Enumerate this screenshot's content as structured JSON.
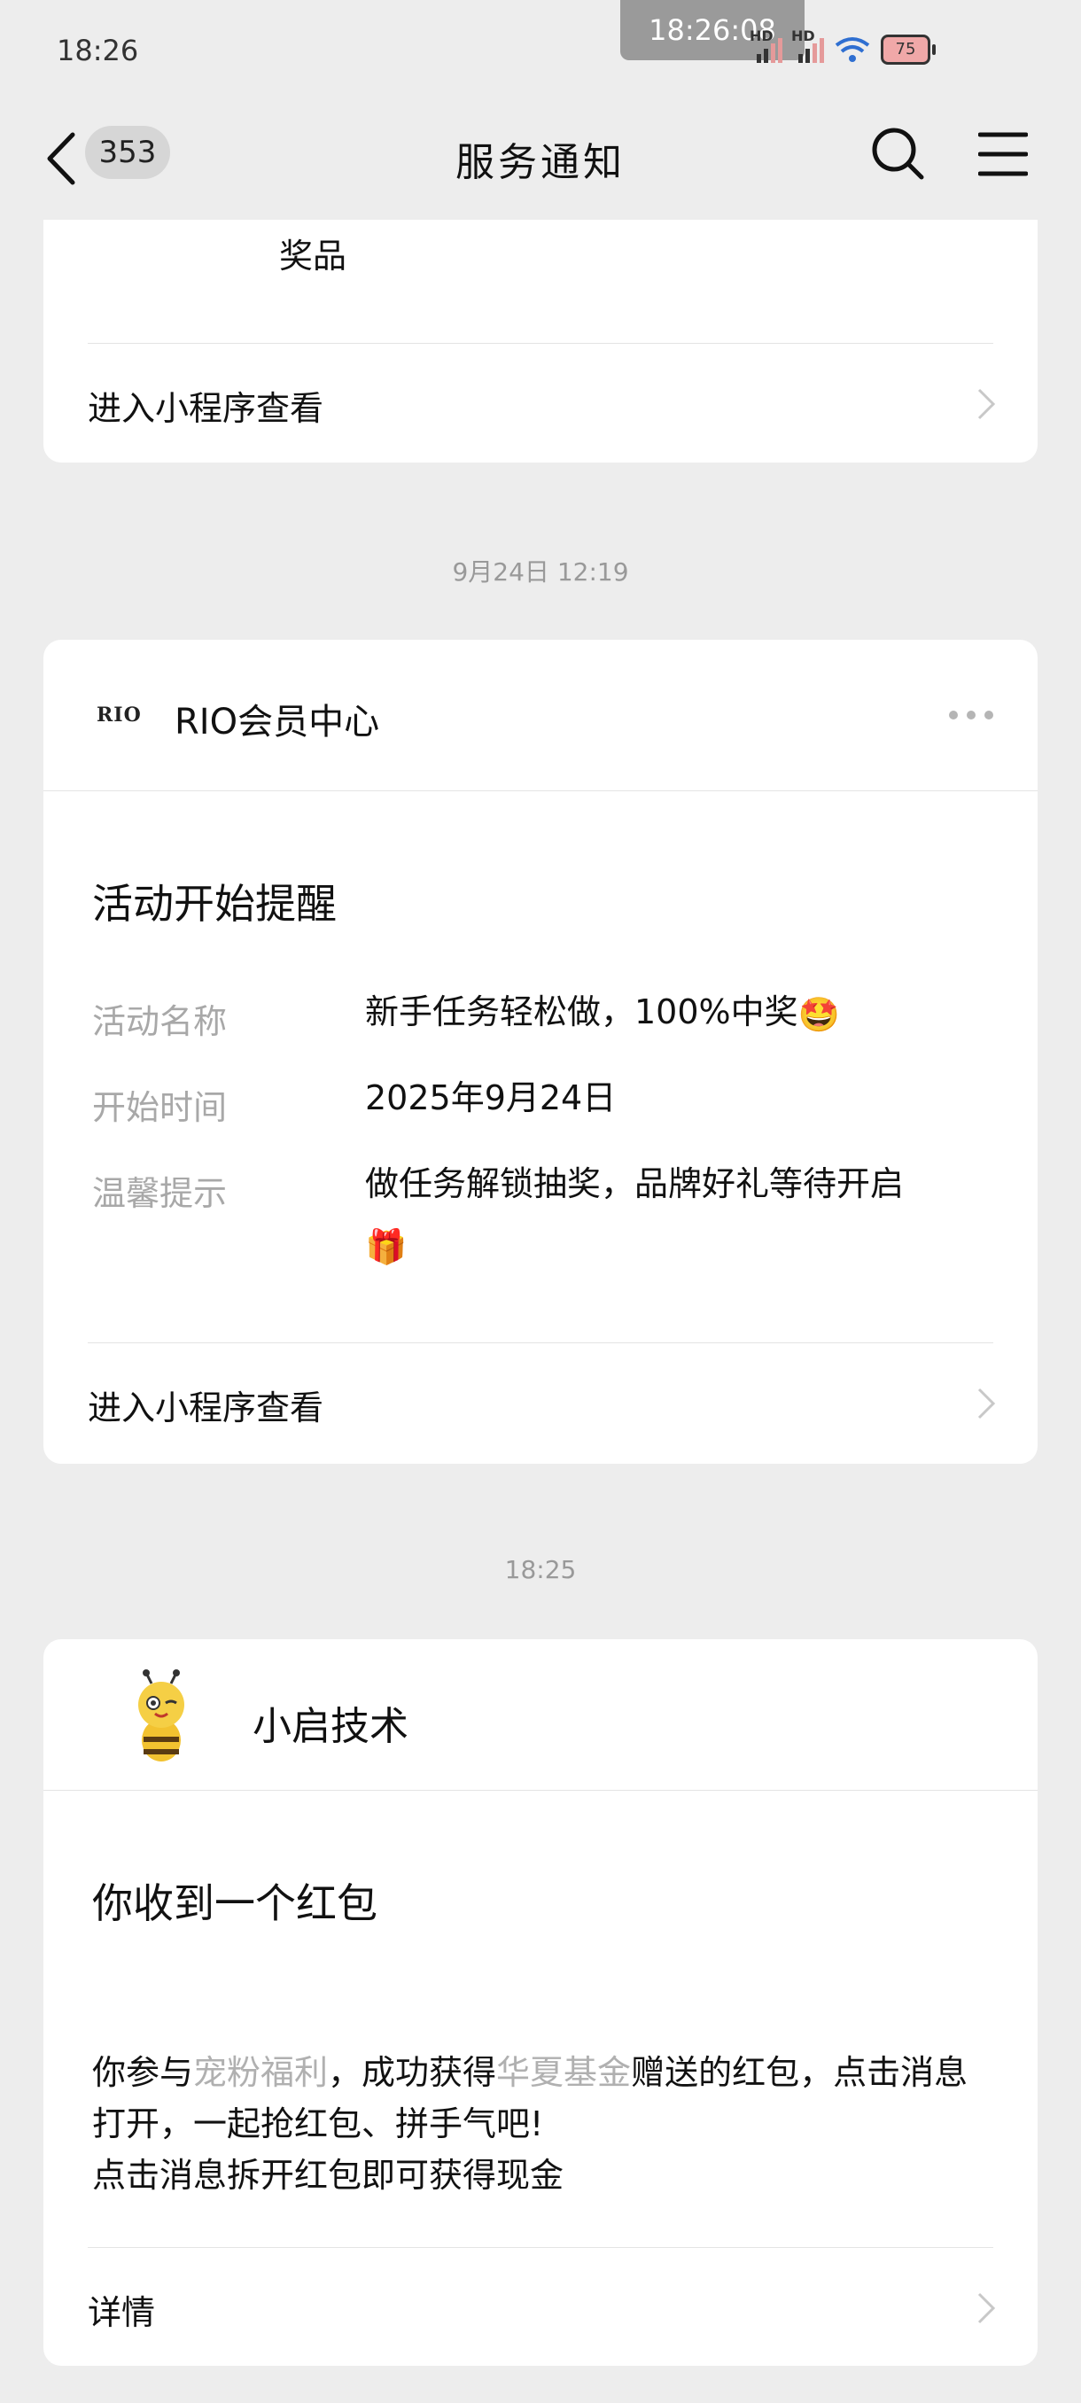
{
  "status_bar": {
    "time": "18:26",
    "screenshot_toast": "18:26:08",
    "battery": "75"
  },
  "nav": {
    "unread_count": "353",
    "title": "服务通知"
  },
  "card_prev": {
    "trailing_text": "奖品",
    "link_label": "进入小程序查看"
  },
  "messages": [
    {
      "timestamp": "9月24日 12:19",
      "logo_text": "RIO",
      "source": "RIO会员中心",
      "title": "活动开始提醒",
      "fields": [
        {
          "key": "活动名称",
          "value": "新手任务轻松做，100%中奖",
          "emoji": "🤩"
        },
        {
          "key": "开始时间",
          "value": "2025年9月24日",
          "emoji": ""
        },
        {
          "key": "温馨提示",
          "value": "做任务解锁抽奖，品牌好礼等待开启",
          "emoji": "🎁"
        }
      ],
      "link_label": "进入小程序查看"
    },
    {
      "timestamp": "18:25",
      "source": "小启技术",
      "title": "你收到一个红包",
      "body": {
        "part1": "你参与",
        "highlight1": "宠粉福利",
        "part2": "，成功获得",
        "highlight2": "华夏基金",
        "part3": "赠送的红包，点击消息打开，一起抢红包、拼手气吧!",
        "line2": "点击消息拆开红包即可获得现金"
      },
      "link_label": "详情"
    }
  ],
  "colors": {
    "background": "#ededed",
    "card": "#ffffff",
    "muted": "#a8a8a8"
  }
}
